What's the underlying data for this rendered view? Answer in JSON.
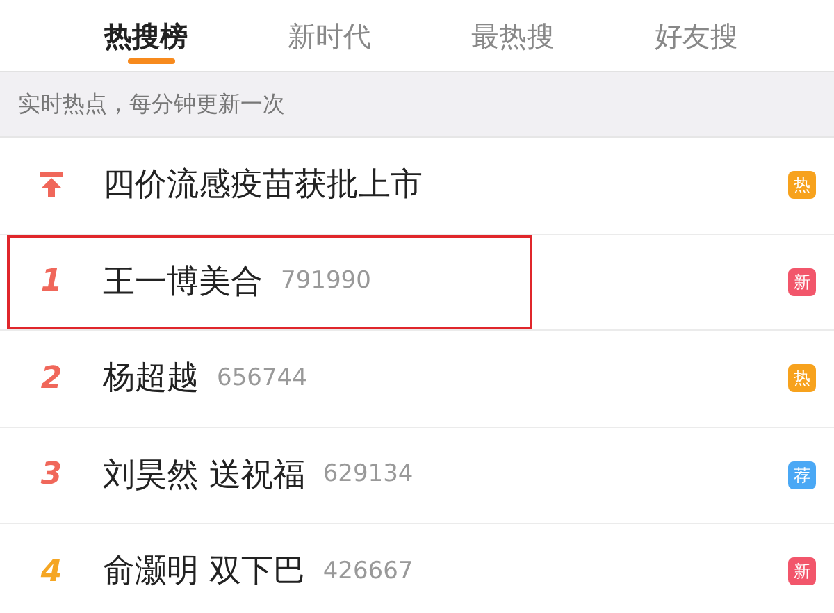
{
  "tabs": [
    {
      "label": "热搜榜",
      "selected": true
    },
    {
      "label": "新时代",
      "selected": false
    },
    {
      "label": "最热搜",
      "selected": false
    },
    {
      "label": "好友搜",
      "selected": false
    }
  ],
  "notice": "实时热点，每分钟更新一次",
  "rows": [
    {
      "kind": "pinned",
      "title": "四价流感疫苗获批上市",
      "badge": {
        "text": "热",
        "color": "#f7a21d"
      },
      "highlighted": false
    },
    {
      "kind": "ranked",
      "rank": "1",
      "color": "#f0675a",
      "title": "王一博美合",
      "count": "791990",
      "badge": {
        "text": "新",
        "color": "#f2566b"
      },
      "highlighted": true
    },
    {
      "kind": "ranked",
      "rank": "2",
      "color": "#f0675a",
      "title": "杨超越",
      "count": "656744",
      "badge": {
        "text": "热",
        "color": "#f7a21d"
      },
      "highlighted": false
    },
    {
      "kind": "ranked",
      "rank": "3",
      "color": "#f0675a",
      "title": "刘昊然 送祝福",
      "count": "629134",
      "badge": {
        "text": "荐",
        "color": "#4aa8f5"
      },
      "highlighted": false
    },
    {
      "kind": "ranked",
      "rank": "4",
      "color": "#f5a623",
      "title": "俞灏明 双下巴",
      "count": "426667",
      "badge": {
        "text": "新",
        "color": "#f2566b"
      },
      "highlighted": false
    }
  ]
}
